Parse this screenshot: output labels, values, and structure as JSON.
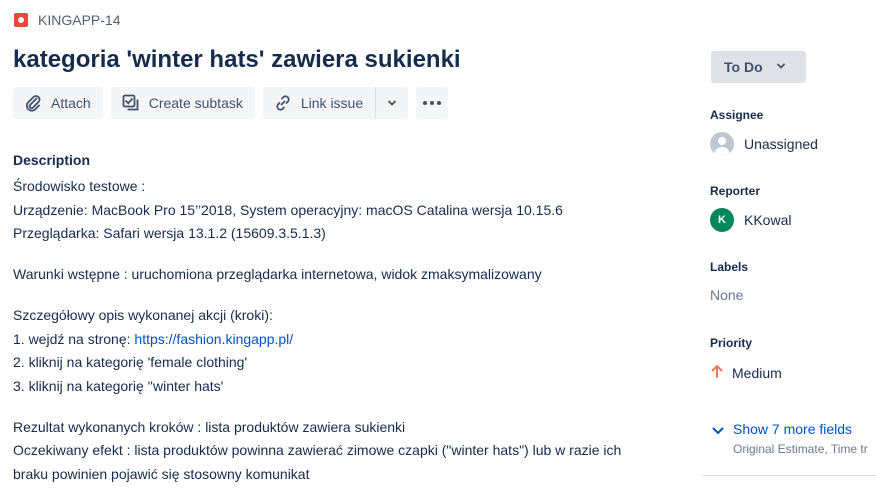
{
  "issue": {
    "key": "KINGAPP-14",
    "title": "kategoria 'winter hats' zawiera sukienki"
  },
  "toolbar": {
    "attach_label": "Attach",
    "subtask_label": "Create subtask",
    "link_label": "Link issue"
  },
  "description": {
    "heading": "Description",
    "lines": [
      "Środowisko testowe :",
      "Urządzenie: MacBook Pro 15’’2018, System operacyjny: macOS Catalina wersja 10.15.6",
      "Przeglądarka: Safari wersja 13.1.2 (15609.3.5.1.3)",
      "Warunki wstępne : uruchomiona przeglądarka internetowa, widok zmaksymalizowany",
      "Szczegółowy opis wykonanej akcji (kroki):",
      "1. wejdź na stronę: ",
      "https://fashion.kingapp.pl/",
      "2. kliknij na kategorię 'female clothing'",
      "3. kliknij na kategorię ''winter hats'",
      "Rezultat wykonanych kroków : lista produktów zawiera sukienki",
      "Oczekiwany efekt : lista produktów powinna zawierać zimowe czapki (\"winter hats\") lub w razie ich",
      "braku powinien pojawić się stosowny komunikat"
    ]
  },
  "sidebar": {
    "status": "To Do",
    "assignee_label": "Assignee",
    "assignee_value": "Unassigned",
    "reporter_label": "Reporter",
    "reporter_initial": "K",
    "reporter_value": "KKowal",
    "labels_label": "Labels",
    "labels_value": "None",
    "priority_label": "Priority",
    "priority_value": "Medium",
    "more_fields_label": "Show 7 more fields",
    "more_fields_sub": "Original Estimate, Time tr"
  },
  "colors": {
    "accent_link": "#0052cc",
    "bug": "#e5493a",
    "priority_medium": "#ff7452",
    "reporter_avatar": "#00875a"
  }
}
